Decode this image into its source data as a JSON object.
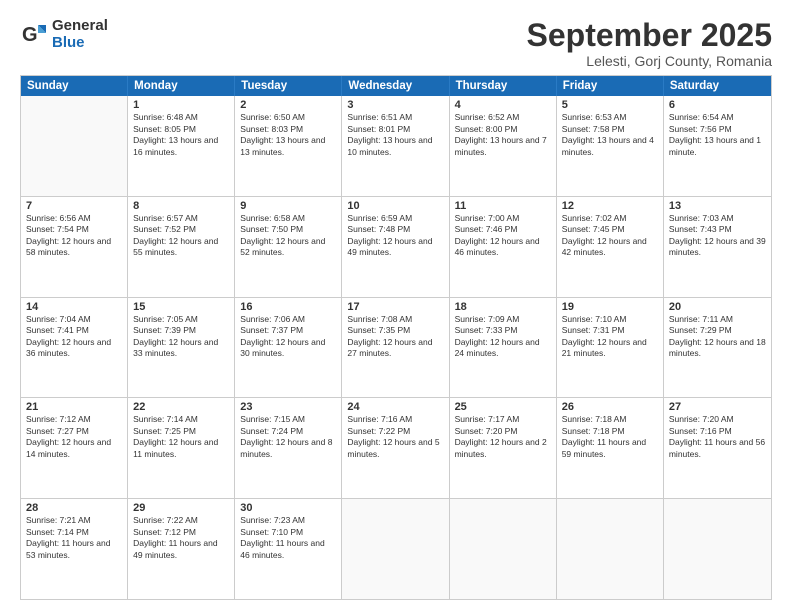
{
  "logo": {
    "general": "General",
    "blue": "Blue"
  },
  "header": {
    "month": "September 2025",
    "location": "Lelesti, Gorj County, Romania"
  },
  "days_of_week": [
    "Sunday",
    "Monday",
    "Tuesday",
    "Wednesday",
    "Thursday",
    "Friday",
    "Saturday"
  ],
  "weeks": [
    [
      {
        "day": "",
        "sunrise": "",
        "sunset": "",
        "daylight": ""
      },
      {
        "day": "1",
        "sunrise": "Sunrise: 6:48 AM",
        "sunset": "Sunset: 8:05 PM",
        "daylight": "Daylight: 13 hours and 16 minutes."
      },
      {
        "day": "2",
        "sunrise": "Sunrise: 6:50 AM",
        "sunset": "Sunset: 8:03 PM",
        "daylight": "Daylight: 13 hours and 13 minutes."
      },
      {
        "day": "3",
        "sunrise": "Sunrise: 6:51 AM",
        "sunset": "Sunset: 8:01 PM",
        "daylight": "Daylight: 13 hours and 10 minutes."
      },
      {
        "day": "4",
        "sunrise": "Sunrise: 6:52 AM",
        "sunset": "Sunset: 8:00 PM",
        "daylight": "Daylight: 13 hours and 7 minutes."
      },
      {
        "day": "5",
        "sunrise": "Sunrise: 6:53 AM",
        "sunset": "Sunset: 7:58 PM",
        "daylight": "Daylight: 13 hours and 4 minutes."
      },
      {
        "day": "6",
        "sunrise": "Sunrise: 6:54 AM",
        "sunset": "Sunset: 7:56 PM",
        "daylight": "Daylight: 13 hours and 1 minute."
      }
    ],
    [
      {
        "day": "7",
        "sunrise": "Sunrise: 6:56 AM",
        "sunset": "Sunset: 7:54 PM",
        "daylight": "Daylight: 12 hours and 58 minutes."
      },
      {
        "day": "8",
        "sunrise": "Sunrise: 6:57 AM",
        "sunset": "Sunset: 7:52 PM",
        "daylight": "Daylight: 12 hours and 55 minutes."
      },
      {
        "day": "9",
        "sunrise": "Sunrise: 6:58 AM",
        "sunset": "Sunset: 7:50 PM",
        "daylight": "Daylight: 12 hours and 52 minutes."
      },
      {
        "day": "10",
        "sunrise": "Sunrise: 6:59 AM",
        "sunset": "Sunset: 7:48 PM",
        "daylight": "Daylight: 12 hours and 49 minutes."
      },
      {
        "day": "11",
        "sunrise": "Sunrise: 7:00 AM",
        "sunset": "Sunset: 7:46 PM",
        "daylight": "Daylight: 12 hours and 46 minutes."
      },
      {
        "day": "12",
        "sunrise": "Sunrise: 7:02 AM",
        "sunset": "Sunset: 7:45 PM",
        "daylight": "Daylight: 12 hours and 42 minutes."
      },
      {
        "day": "13",
        "sunrise": "Sunrise: 7:03 AM",
        "sunset": "Sunset: 7:43 PM",
        "daylight": "Daylight: 12 hours and 39 minutes."
      }
    ],
    [
      {
        "day": "14",
        "sunrise": "Sunrise: 7:04 AM",
        "sunset": "Sunset: 7:41 PM",
        "daylight": "Daylight: 12 hours and 36 minutes."
      },
      {
        "day": "15",
        "sunrise": "Sunrise: 7:05 AM",
        "sunset": "Sunset: 7:39 PM",
        "daylight": "Daylight: 12 hours and 33 minutes."
      },
      {
        "day": "16",
        "sunrise": "Sunrise: 7:06 AM",
        "sunset": "Sunset: 7:37 PM",
        "daylight": "Daylight: 12 hours and 30 minutes."
      },
      {
        "day": "17",
        "sunrise": "Sunrise: 7:08 AM",
        "sunset": "Sunset: 7:35 PM",
        "daylight": "Daylight: 12 hours and 27 minutes."
      },
      {
        "day": "18",
        "sunrise": "Sunrise: 7:09 AM",
        "sunset": "Sunset: 7:33 PM",
        "daylight": "Daylight: 12 hours and 24 minutes."
      },
      {
        "day": "19",
        "sunrise": "Sunrise: 7:10 AM",
        "sunset": "Sunset: 7:31 PM",
        "daylight": "Daylight: 12 hours and 21 minutes."
      },
      {
        "day": "20",
        "sunrise": "Sunrise: 7:11 AM",
        "sunset": "Sunset: 7:29 PM",
        "daylight": "Daylight: 12 hours and 18 minutes."
      }
    ],
    [
      {
        "day": "21",
        "sunrise": "Sunrise: 7:12 AM",
        "sunset": "Sunset: 7:27 PM",
        "daylight": "Daylight: 12 hours and 14 minutes."
      },
      {
        "day": "22",
        "sunrise": "Sunrise: 7:14 AM",
        "sunset": "Sunset: 7:25 PM",
        "daylight": "Daylight: 12 hours and 11 minutes."
      },
      {
        "day": "23",
        "sunrise": "Sunrise: 7:15 AM",
        "sunset": "Sunset: 7:24 PM",
        "daylight": "Daylight: 12 hours and 8 minutes."
      },
      {
        "day": "24",
        "sunrise": "Sunrise: 7:16 AM",
        "sunset": "Sunset: 7:22 PM",
        "daylight": "Daylight: 12 hours and 5 minutes."
      },
      {
        "day": "25",
        "sunrise": "Sunrise: 7:17 AM",
        "sunset": "Sunset: 7:20 PM",
        "daylight": "Daylight: 12 hours and 2 minutes."
      },
      {
        "day": "26",
        "sunrise": "Sunrise: 7:18 AM",
        "sunset": "Sunset: 7:18 PM",
        "daylight": "Daylight: 11 hours and 59 minutes."
      },
      {
        "day": "27",
        "sunrise": "Sunrise: 7:20 AM",
        "sunset": "Sunset: 7:16 PM",
        "daylight": "Daylight: 11 hours and 56 minutes."
      }
    ],
    [
      {
        "day": "28",
        "sunrise": "Sunrise: 7:21 AM",
        "sunset": "Sunset: 7:14 PM",
        "daylight": "Daylight: 11 hours and 53 minutes."
      },
      {
        "day": "29",
        "sunrise": "Sunrise: 7:22 AM",
        "sunset": "Sunset: 7:12 PM",
        "daylight": "Daylight: 11 hours and 49 minutes."
      },
      {
        "day": "30",
        "sunrise": "Sunrise: 7:23 AM",
        "sunset": "Sunset: 7:10 PM",
        "daylight": "Daylight: 11 hours and 46 minutes."
      },
      {
        "day": "",
        "sunrise": "",
        "sunset": "",
        "daylight": ""
      },
      {
        "day": "",
        "sunrise": "",
        "sunset": "",
        "daylight": ""
      },
      {
        "day": "",
        "sunrise": "",
        "sunset": "",
        "daylight": ""
      },
      {
        "day": "",
        "sunrise": "",
        "sunset": "",
        "daylight": ""
      }
    ]
  ]
}
